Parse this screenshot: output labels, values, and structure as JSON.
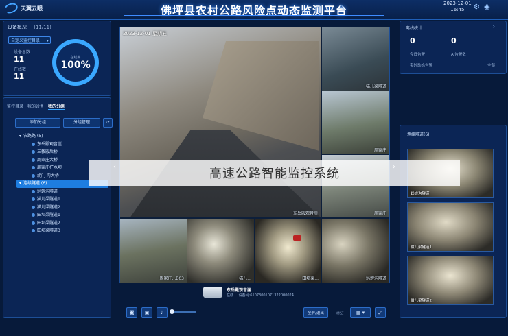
{
  "header": {
    "logo_text": "天翼云眼",
    "title": "佛坪县农村公路风险点动态监测平台",
    "date": "2023-12-01",
    "time": "16:45"
  },
  "device_overview": {
    "title": "设备概况",
    "count": "(11/11)",
    "select_value": "自定义监控目录",
    "online_label": "设备总数",
    "online_value": "11",
    "total_label": "在线数",
    "total_value": "11",
    "ring_label": "在线率",
    "ring_value": "100%",
    "ring_fraction": 1.0
  },
  "tree_panel": {
    "tabs": [
      {
        "label": "监控目录",
        "active": false
      },
      {
        "label": "我的设备",
        "active": false
      },
      {
        "label": "我的分组",
        "active": true
      }
    ],
    "buttons": [
      "添加分组",
      "分组管理"
    ],
    "items": [
      {
        "label": "农路路 (5)",
        "level": 0,
        "highlight": false
      },
      {
        "label": "东岳殿观音崖",
        "level": 1,
        "highlight": false
      },
      {
        "label": "三教殿后桥",
        "level": 1,
        "highlight": false
      },
      {
        "label": "周家庄大桥",
        "level": 1,
        "highlight": false
      },
      {
        "label": "周家庄扩水坝",
        "level": 1,
        "highlight": false
      },
      {
        "label": "胡门 沟大桥",
        "level": 1,
        "highlight": false
      },
      {
        "label": "连续隧道 (6)",
        "level": 0,
        "highlight": true
      },
      {
        "label": "蚂蝗沟隧道",
        "level": 1,
        "highlight": false
      },
      {
        "label": "猫儿梁隧道1",
        "level": 1,
        "highlight": false
      },
      {
        "label": "猫儿梁隧道2",
        "level": 1,
        "highlight": false
      },
      {
        "label": "田坝梁隧道1",
        "level": 1,
        "highlight": false
      },
      {
        "label": "田坝梁隧道2",
        "level": 1,
        "highlight": false
      },
      {
        "label": "田坝梁隧道3",
        "level": 1,
        "highlight": false
      }
    ]
  },
  "main_view": {
    "big_stamp": "2023-12-01 星期五",
    "big_label": "东岳殿观音崖",
    "side_cams": [
      {
        "label": "猫儿梁隧道"
      },
      {
        "label": "周家庄"
      },
      {
        "label": "周家庄"
      }
    ],
    "bottom_cams": [
      {
        "label": "周家庄...B03"
      },
      {
        "label": "猫儿..."
      },
      {
        "label": "田坝梁..."
      },
      {
        "label": "蚂蝗沟隧道"
      }
    ],
    "selected_camera_name": "东岳殿观音崖",
    "selected_camera_status": "在线",
    "selected_camera_id": "设备码:61073001071322000024"
  },
  "controls": {
    "split_label": "全屏/退出",
    "clear_label": "清空"
  },
  "right_stats": {
    "title": "离线统计",
    "today_label": "今日告警",
    "today_value": "0",
    "ai_label": "AI告警数",
    "ai_value": "0",
    "realtime_label": "实时动态告警",
    "all_label": "全部"
  },
  "right_thumbs": {
    "title": "连续隧道(6)",
    "items": [
      {
        "label": "蚂蝗沟隧道"
      },
      {
        "label": "猫儿梁隧道1"
      },
      {
        "label": "猫儿梁隧道2"
      }
    ]
  },
  "overlay": {
    "text": "高速公路智能监控系统"
  }
}
